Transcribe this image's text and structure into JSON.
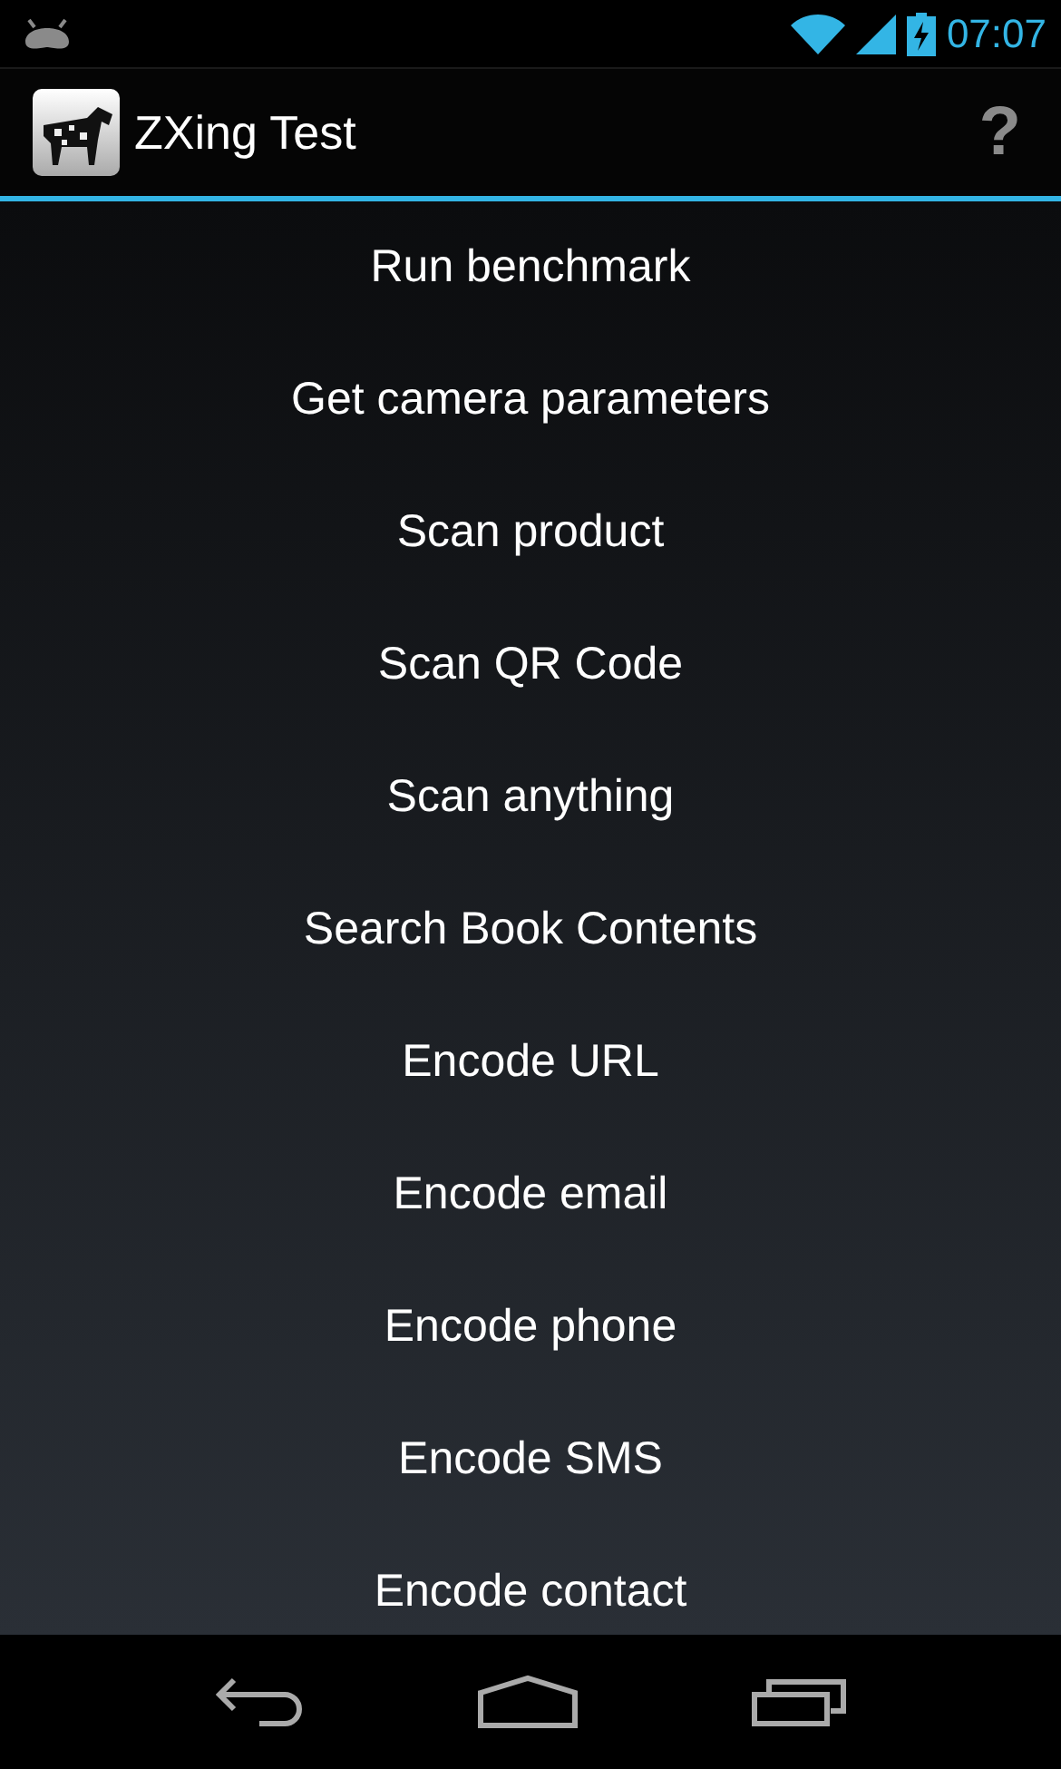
{
  "status_bar": {
    "time": "07:07"
  },
  "action_bar": {
    "title": "ZXing Test",
    "help": "?"
  },
  "menu_items": [
    {
      "label": "Run benchmark"
    },
    {
      "label": "Get camera parameters"
    },
    {
      "label": "Scan product"
    },
    {
      "label": "Scan QR Code"
    },
    {
      "label": "Scan anything"
    },
    {
      "label": "Search Book Contents"
    },
    {
      "label": "Encode URL"
    },
    {
      "label": "Encode email"
    },
    {
      "label": "Encode phone"
    },
    {
      "label": "Encode SMS"
    },
    {
      "label": "Encode contact"
    }
  ]
}
